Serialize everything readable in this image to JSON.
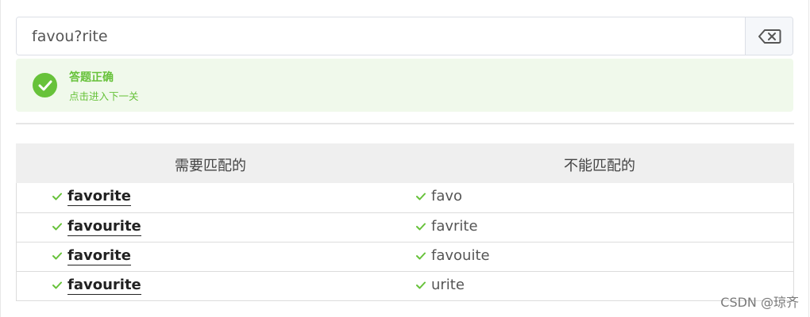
{
  "regex_input": {
    "value": "favou?rite"
  },
  "clear_button": {
    "icon": "backspace-icon"
  },
  "alert": {
    "type": "success",
    "icon": "check-circle-icon",
    "title": "答题正确",
    "description": "点击进入下一关",
    "color": "#67c23a",
    "background": "#f0f9eb"
  },
  "table": {
    "headers": [
      "需要匹配的",
      "不能匹配的"
    ],
    "rows": [
      {
        "match": "favorite",
        "no_match": "favo"
      },
      {
        "match": "favourite",
        "no_match": "favrite"
      },
      {
        "match": "favorite",
        "no_match": "favouite"
      },
      {
        "match": "favourite",
        "no_match": "urite"
      }
    ],
    "status_icon": "checkmark-icon",
    "status_color": "#67c23a"
  },
  "watermark": "CSDN @琼齐"
}
